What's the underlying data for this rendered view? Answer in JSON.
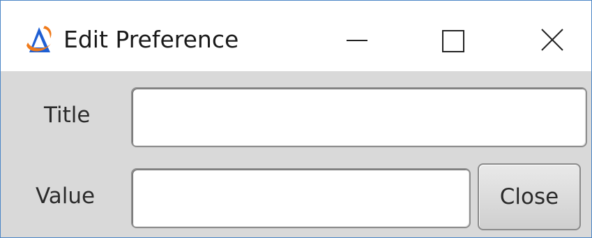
{
  "window": {
    "title": "Edit Preference",
    "app_icon": "app-logo-icon",
    "controls": {
      "minimize_icon": "minimize-icon",
      "maximize_icon": "maximize-icon",
      "close_icon": "close-icon"
    }
  },
  "form": {
    "title_label": "Title",
    "title_value": "",
    "value_label": "Value",
    "value_value": "",
    "close_button_label": "Close"
  },
  "colors": {
    "window_border": "#4c86c6",
    "titlebar_bg": "#ffffff",
    "client_bg": "#d9d9d9",
    "logo_blue": "#1f5fd3",
    "logo_orange": "#f07a1a"
  }
}
